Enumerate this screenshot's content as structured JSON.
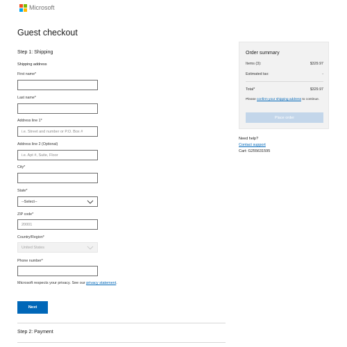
{
  "header": {
    "brand": "Microsoft",
    "logo_colors": [
      "#f25022",
      "#7fba00",
      "#00a4ef",
      "#ffb900"
    ]
  },
  "page_title": "Guest checkout",
  "step1": {
    "title": "Step 1: Shipping",
    "section": "Shipping address",
    "fields": {
      "first_name": {
        "label": "First name*",
        "value": "",
        "placeholder": ""
      },
      "last_name": {
        "label": "Last name*",
        "value": "",
        "placeholder": ""
      },
      "address1": {
        "label": "Address line 1*",
        "value": "",
        "placeholder": "i.e. Street and number or P.O. Box #"
      },
      "address2": {
        "label": "Address line 2 (Optional)",
        "value": "",
        "placeholder": "i.e. Apt #, Suite, Floor"
      },
      "city": {
        "label": "City*",
        "value": "",
        "placeholder": ""
      },
      "state": {
        "label": "State*",
        "selected": "--Select--"
      },
      "zip": {
        "label": "ZIP code*",
        "value": "",
        "placeholder": "20001"
      },
      "country": {
        "label": "Country/Region*",
        "selected": "United States"
      },
      "phone": {
        "label": "Phone number*",
        "value": "",
        "placeholder": ""
      }
    },
    "privacy_text": "Microsoft respects your privacy. See our ",
    "privacy_link": "privacy statement",
    "privacy_end": ".",
    "next_label": "Next"
  },
  "step2": {
    "title": "Step 2: Payment"
  },
  "summary": {
    "title": "Order summary",
    "items_label": "Items (3):",
    "items_value": "$329.97",
    "tax_label": "Estimated tax:",
    "tax_value": "-",
    "total_label": "Total*",
    "total_value": "$329.97",
    "note_prefix": "Please ",
    "note_link": "confirm your shipping address",
    "note_suffix": " to continue.",
    "place_order_label": "Place order"
  },
  "help": {
    "title": "Need help?",
    "contact_link": "Contact support",
    "cart": "Cart: G255631595"
  },
  "colors": {
    "accent": "#0067b8",
    "place_order_disabled": "#c3d6ea",
    "summary_bg": "#f2f2f2"
  }
}
